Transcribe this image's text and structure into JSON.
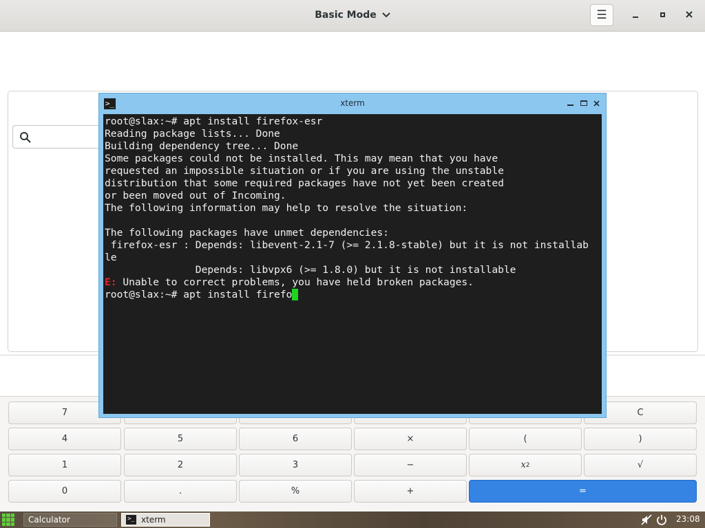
{
  "calculator": {
    "title": "Basic Mode",
    "search_placeholder": "",
    "keys": {
      "row1": [
        "7",
        "",
        "",
        "",
        "",
        "C"
      ],
      "row2": [
        "4",
        "5",
        "6",
        "×",
        "(",
        ")"
      ],
      "row3": [
        "1",
        "2",
        "3",
        "−",
        "x",
        "√"
      ],
      "row3_sup": "2",
      "row4": [
        "0",
        ".",
        "%",
        "+",
        "="
      ]
    },
    "accent_color": "#3584e4"
  },
  "xterm": {
    "title": "xterm",
    "lines": [
      "root@slax:~# apt install firefox-esr",
      "Reading package lists... Done",
      "Building dependency tree... Done",
      "Some packages could not be installed. This may mean that you have",
      "requested an impossible situation or if you are using the unstable",
      "distribution that some required packages have not yet been created",
      "or been moved out of Incoming.",
      "The following information may help to resolve the situation:",
      "",
      "The following packages have unmet dependencies:",
      " firefox-esr : Depends: libevent-2.1-7 (>= 2.1.8-stable) but it is not installab",
      "le",
      "               Depends: libvpx6 (>= 1.8.0) but it is not installable"
    ],
    "error_prefix": "E:",
    "error_text": " Unable to correct problems, you have held broken packages.",
    "prompt": "root@slax:~# ",
    "current_input": "apt install firefo",
    "error_color": "#e8262b",
    "cursor_color": "#1ed41e"
  },
  "taskbar": {
    "tasks": [
      "Calculator",
      "xterm"
    ],
    "clock": "23:08",
    "icons": [
      "start-menu-icon",
      "volume-muted-icon",
      "power-icon"
    ]
  }
}
